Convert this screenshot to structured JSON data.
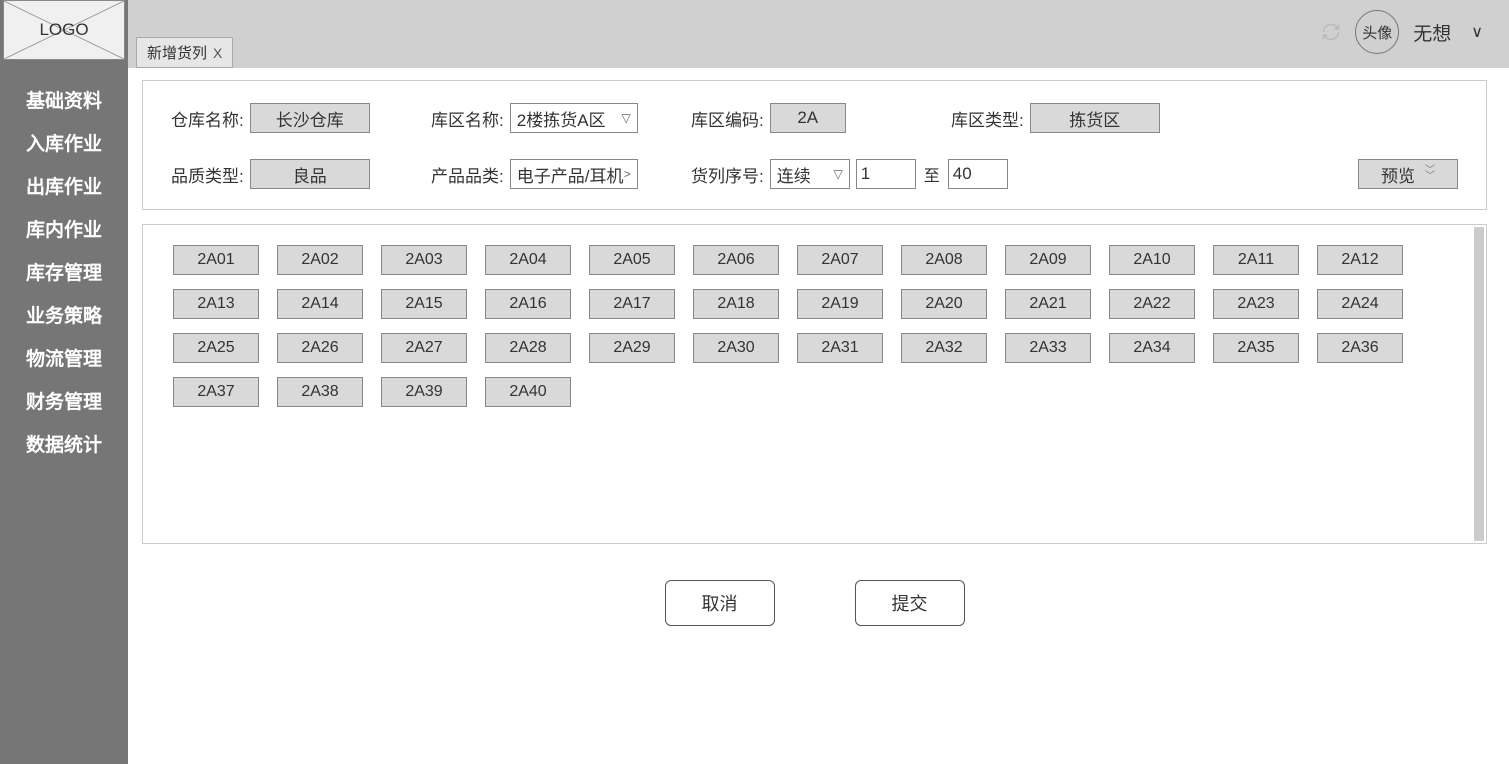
{
  "logo_text": "LOGO",
  "sidebar": {
    "items": [
      {
        "label": "基础资料"
      },
      {
        "label": "入库作业"
      },
      {
        "label": "出库作业"
      },
      {
        "label": "库内作业"
      },
      {
        "label": "库存管理"
      },
      {
        "label": "业务策略"
      },
      {
        "label": "物流管理"
      },
      {
        "label": "财务管理"
      },
      {
        "label": "数据统计"
      }
    ]
  },
  "tabs": [
    {
      "label": "新增货列",
      "close": "X"
    }
  ],
  "header": {
    "avatar_text": "头像",
    "username": "无想",
    "chev": "∨"
  },
  "form": {
    "warehouse_label": "仓库名称:",
    "warehouse_value": "长沙仓库",
    "zone_name_label": "库区名称:",
    "zone_name_value": "2楼拣货A区",
    "zone_code_label": "库区编码:",
    "zone_code_value": "2A",
    "zone_type_label": "库区类型:",
    "zone_type_value": "拣货区",
    "quality_label": "品质类型:",
    "quality_value": "良品",
    "category_label": "产品品类:",
    "category_value": "电子产品/耳机",
    "category_more": ">",
    "seq_label": "货列序号:",
    "seq_mode": "连续",
    "seq_from": "1",
    "seq_to_label": "至",
    "seq_to": "40",
    "preview_label": "预览"
  },
  "cells": [
    "2A01",
    "2A02",
    "2A03",
    "2A04",
    "2A05",
    "2A06",
    "2A07",
    "2A08",
    "2A09",
    "2A10",
    "2A11",
    "2A12",
    "2A13",
    "2A14",
    "2A15",
    "2A16",
    "2A17",
    "2A18",
    "2A19",
    "2A20",
    "2A21",
    "2A22",
    "2A23",
    "2A24",
    "2A25",
    "2A26",
    "2A27",
    "2A28",
    "2A29",
    "2A30",
    "2A31",
    "2A32",
    "2A33",
    "2A34",
    "2A35",
    "2A36",
    "2A37",
    "2A38",
    "2A39",
    "2A40"
  ],
  "footer": {
    "cancel": "取消",
    "submit": "提交"
  }
}
